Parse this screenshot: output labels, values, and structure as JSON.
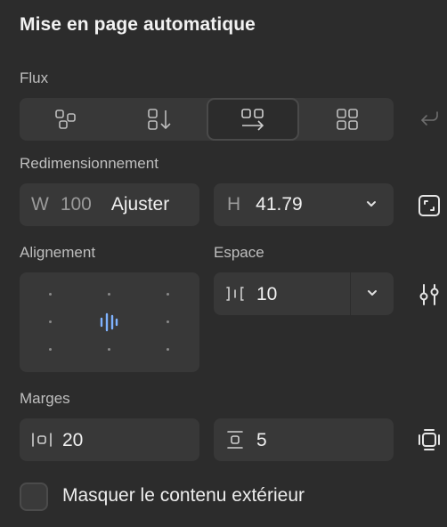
{
  "panel": {
    "title": "Mise en page automatique"
  },
  "flux": {
    "label": "Flux",
    "options": [
      {
        "name": "freeform",
        "icon": "freeform-layout-icon",
        "selected": false
      },
      {
        "name": "vertical",
        "icon": "vertical-stack-icon",
        "selected": false
      },
      {
        "name": "horizontal",
        "icon": "horizontal-stack-icon",
        "selected": true
      },
      {
        "name": "grid",
        "icon": "grid-layout-icon",
        "selected": false
      }
    ],
    "wrap_icon": "wrap-arrow-icon"
  },
  "resize": {
    "label": "Redimensionnement",
    "width_prefix": "W",
    "width_value": "100",
    "width_mode": "Ajuster",
    "height_prefix": "H",
    "height_value": "41.79",
    "height_dropdown_icon": "chevron-down-icon",
    "resize_icon": "resize-corners-icon"
  },
  "alignment": {
    "label": "Alignement",
    "selected_cell": "center"
  },
  "spacing": {
    "label": "Espace",
    "value": "10",
    "icon": "horizontal-gap-icon",
    "dropdown_icon": "chevron-down-icon",
    "settings_icon": "sliders-icon"
  },
  "margins": {
    "label": "Marges",
    "horizontal_value": "20",
    "vertical_value": "5",
    "horizontal_icon": "horizontal-padding-icon",
    "vertical_icon": "vertical-padding-icon",
    "individual_icon": "individual-padding-icon"
  },
  "clip": {
    "label": "Masquer le contenu extérieur",
    "checked": false
  },
  "colors": {
    "background": "#2c2c2c",
    "field": "#383838",
    "accent": "#7fb3ff"
  }
}
